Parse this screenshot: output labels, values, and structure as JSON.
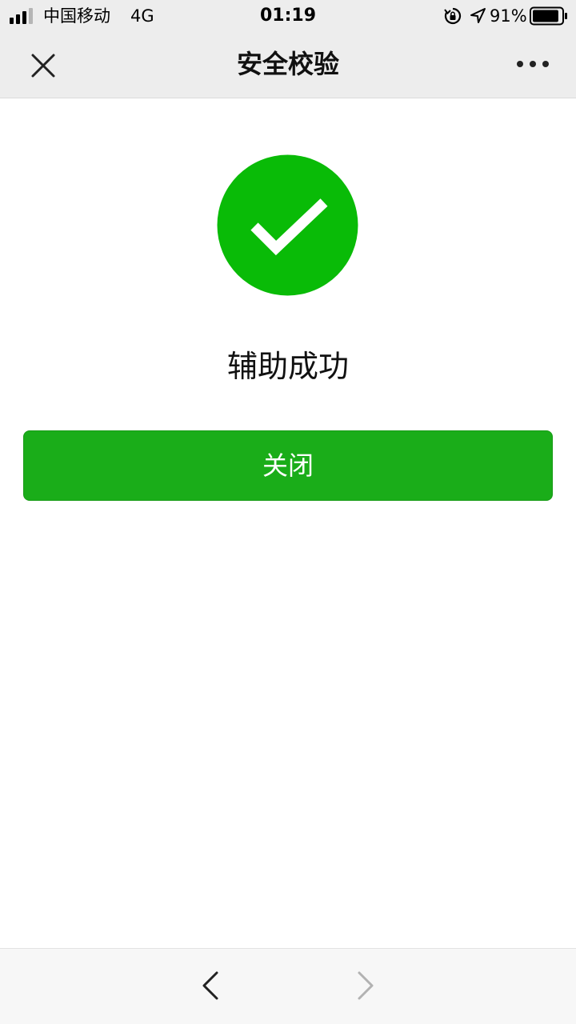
{
  "status_bar": {
    "carrier": "中国移动",
    "network": "4G",
    "time": "01:19",
    "battery_percent": "91%",
    "battery_level": 0.91,
    "icons": [
      "signal-icon",
      "rotation-lock-icon",
      "location-arrow-icon",
      "battery-icon"
    ]
  },
  "nav": {
    "title": "安全校验",
    "close_icon": "close-icon",
    "more_icon": "more-icon"
  },
  "main": {
    "status_icon": "check-circle-icon",
    "result_text": "辅助成功",
    "close_button_label": "关闭"
  },
  "toolbar": {
    "back_icon": "chevron-left-icon",
    "forward_icon": "chevron-right-icon",
    "forward_enabled": false
  },
  "colors": {
    "accent_green": "#1aad19",
    "icon_green": "#09bb07",
    "nav_background": "#ededed"
  }
}
